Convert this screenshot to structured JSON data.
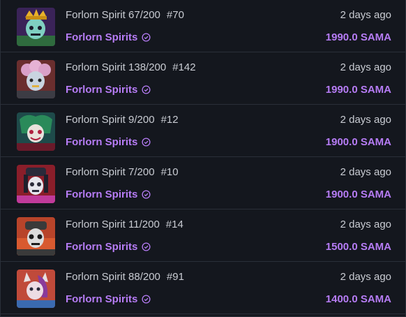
{
  "accent_color": "#b67cf5",
  "verified_icon": "verified-badge-icon",
  "sales": [
    {
      "name": "Forlorn Spirit 67/200",
      "number": "#70",
      "collection": "Forlorn Spirits",
      "time": "2 days ago",
      "price": "1990.0 SAMA"
    },
    {
      "name": "Forlorn Spirit 138/200",
      "number": "#142",
      "collection": "Forlorn Spirits",
      "time": "2 days ago",
      "price": "1990.0 SAMA"
    },
    {
      "name": "Forlorn Spirit 9/200",
      "number": "#12",
      "collection": "Forlorn Spirits",
      "time": "2 days ago",
      "price": "1900.0 SAMA"
    },
    {
      "name": "Forlorn Spirit 7/200",
      "number": "#10",
      "collection": "Forlorn Spirits",
      "time": "2 days ago",
      "price": "1900.0 SAMA"
    },
    {
      "name": "Forlorn Spirit 11/200",
      "number": "#14",
      "collection": "Forlorn Spirits",
      "time": "2 days ago",
      "price": "1500.0 SAMA"
    },
    {
      "name": "Forlorn Spirit 88/200",
      "number": "#91",
      "collection": "Forlorn Spirits",
      "time": "2 days ago",
      "price": "1400.0 SAMA"
    }
  ]
}
